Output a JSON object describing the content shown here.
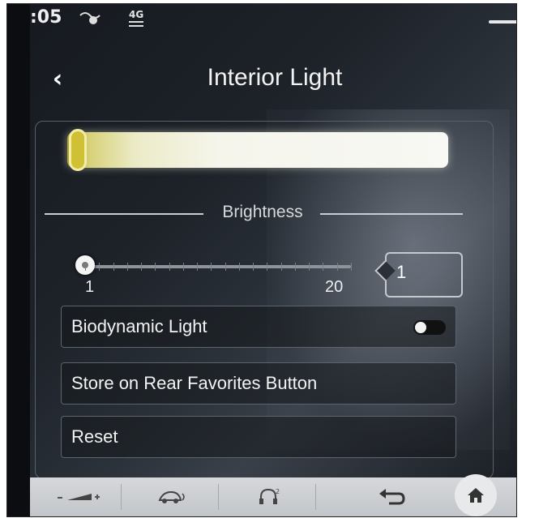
{
  "status_bar": {
    "time": ":05",
    "icons": [
      "navigation-status-icon",
      "network-4g-icon"
    ],
    "network_label": "4G"
  },
  "header": {
    "title": "Interior Light",
    "back_icon": "chevron-left-icon"
  },
  "ambient_light": {
    "colors": [
      "#cfc035",
      "#f5f5ec"
    ]
  },
  "brightness": {
    "label": "Brightness",
    "min_label": "1",
    "max_label": "20",
    "value": "1",
    "min": 1,
    "max": 20
  },
  "options": {
    "biodynamic_label": "Biodynamic Light",
    "biodynamic_on": false,
    "store_label": "Store on Rear Favorites Button",
    "reset_label": "Reset"
  },
  "bottom_bar": {
    "items": [
      "volume-icon",
      "driver-assist-icon",
      "headphones-icon",
      "back-arrow-icon",
      "home-icon"
    ]
  }
}
